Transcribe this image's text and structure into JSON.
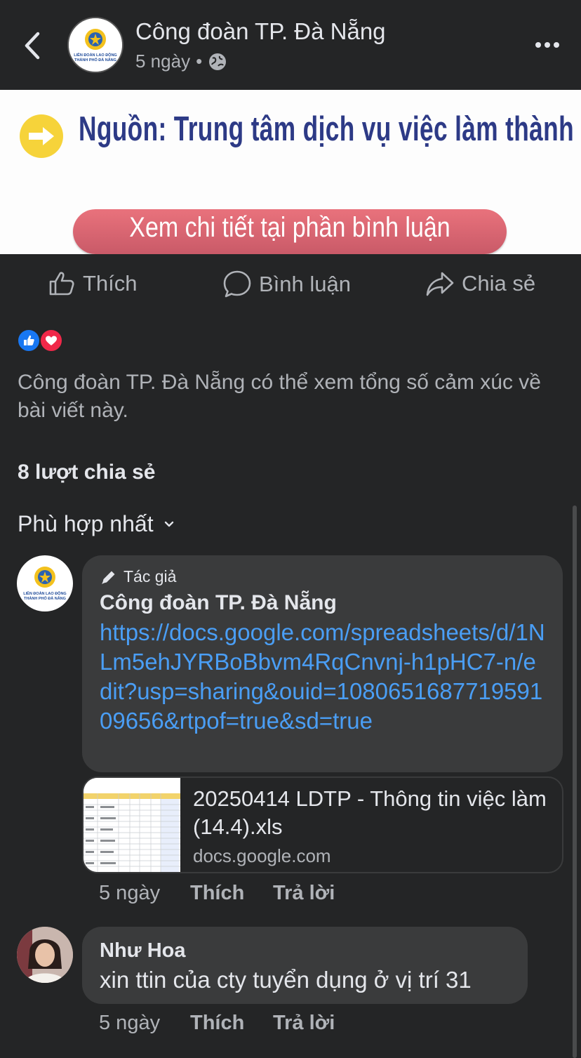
{
  "header": {
    "page_name": "Công đoàn TP. Đà Nẵng",
    "time": "5 ngày",
    "separator": "•",
    "privacy_icon": "globe-icon",
    "logo_text_1": "LIÊN ĐOÀN LAO ĐỘNG",
    "logo_text_2": "THÀNH PHỐ ĐÀ NẴNG"
  },
  "banner": {
    "source_text": "Nguồn: Trung tâm dịch vụ việc làm thành phố",
    "pill_text": "Xem chi tiết tại phần bình luận"
  },
  "actions": {
    "like": "Thích",
    "comment": "Bình luận",
    "share": "Chia sẻ"
  },
  "reactions": {
    "icons": [
      "like-reaction-icon",
      "love-reaction-icon"
    ],
    "colors": {
      "like": "#1877f2",
      "love": "#f02849"
    }
  },
  "summary": "Công đoàn TP. Đà Nẵng có thể xem tổng số cảm xúc về bài viết này.",
  "shares": "8 lượt chia sẻ",
  "sort": {
    "label": "Phù hợp nhất"
  },
  "comments": [
    {
      "badge": "Tác giả",
      "author": "Công đoàn TP. Đà Nẵng",
      "link": "https://docs.google.com/spreadsheets/d/1NLm5ehJYRBoBbvm4RqCnvnj-h1pHC7-n/edit?usp=sharing&ouid=108065168771959109656&rtpof=true&sd=true",
      "preview_title": "20250414 LDTP - Thông tin việc làm (14.4).xls",
      "preview_domain": "docs.google.com",
      "time": "5 ngày",
      "like": "Thích",
      "reply": "Trả lời"
    },
    {
      "author": "Như Hoa",
      "text": "xin ttin  của cty tuyển dụng ở vị trí 31",
      "time": "5 ngày",
      "like": "Thích",
      "reply": "Trả lời"
    }
  ],
  "colors": {
    "background": "#242526",
    "bubble": "#3a3b3c",
    "link": "#4a9ef5",
    "secondary_text": "#b0b3b8"
  }
}
